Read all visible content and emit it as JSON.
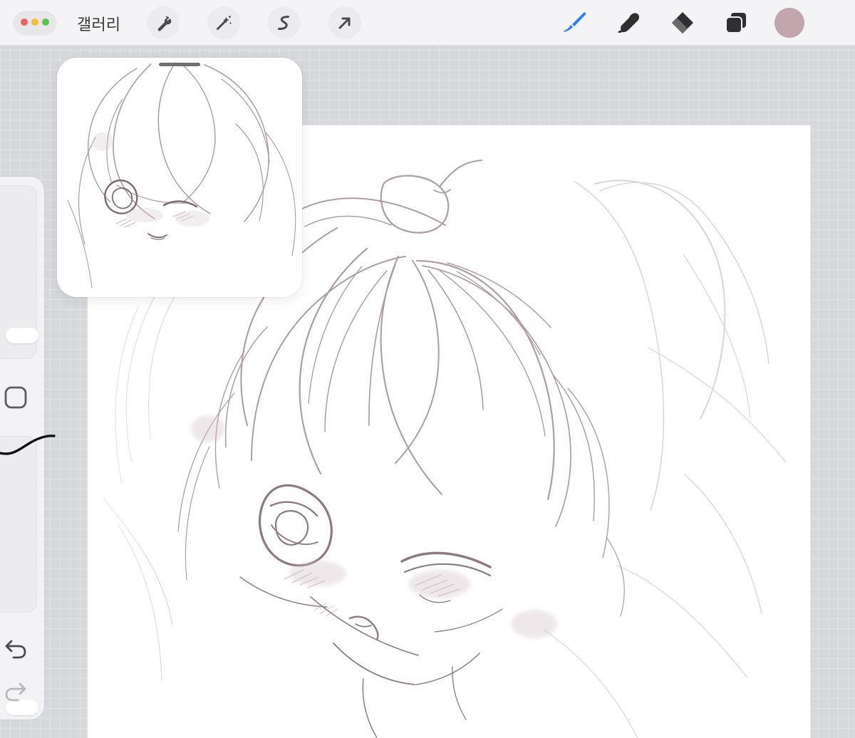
{
  "app": {
    "gallery_label": "갤러리"
  },
  "toolbar": {
    "left_icons": [
      "wrench-icon",
      "magic-wand-icon",
      "selection-icon",
      "arrow-icon"
    ],
    "right_icons": [
      "brush-icon",
      "smudge-icon",
      "eraser-icon",
      "layers-icon",
      "color-swatch"
    ],
    "selected_tool": "brush-icon",
    "accent_color": "#2f7cf6",
    "selected_color": "#c3a5ad"
  },
  "sidebar": {
    "icons": [
      "square-icon",
      "undo-icon",
      "redo-icon"
    ],
    "brush_size_slider_level": 0.18,
    "opacity_slider_level": 0.95
  },
  "canvas": {
    "background": "#ffffff",
    "sketch_color": "#8f7a82",
    "reference_window": "reference-preview"
  }
}
